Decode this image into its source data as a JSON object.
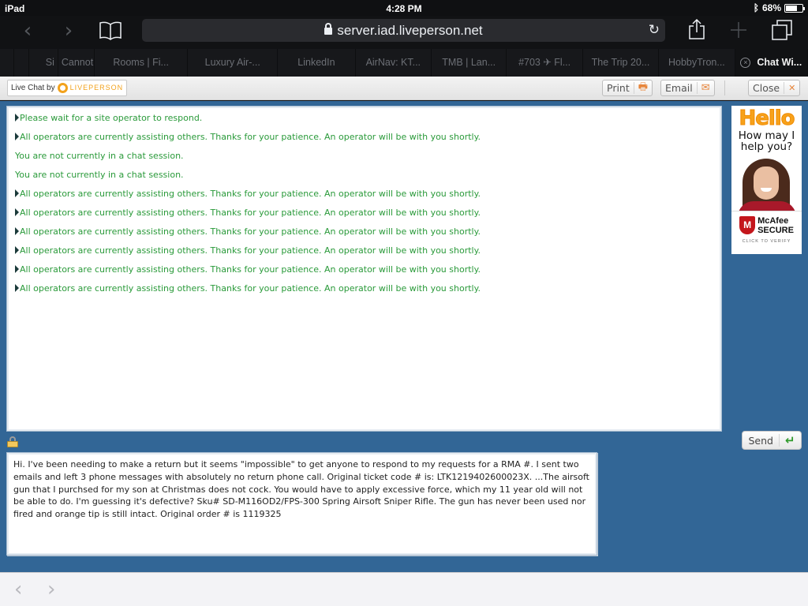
{
  "statusbar": {
    "device": "iPad",
    "time": "4:28 PM",
    "bluetooth_icon": "bluetooth-icon",
    "battery_percent": "68%",
    "battery_level": 0.68
  },
  "browser": {
    "url": "server.iad.liveperson.net",
    "icons": {
      "back": "chevron-left-icon",
      "forward": "chevron-right-icon",
      "bookmarks": "book-icon",
      "lock": "lock-icon",
      "reload": "reload-icon",
      "share": "share-icon",
      "new_tab": "plus-icon",
      "tabs": "tabs-icon"
    },
    "glyphs": {
      "back": "‹",
      "forward": "›",
      "reload": "↻"
    },
    "tabs": [
      {
        "label": ""
      },
      {
        "label": ""
      },
      {
        "label": "Si"
      },
      {
        "label": "Cannot ("
      },
      {
        "label": "Rooms | Fi..."
      },
      {
        "label": "Luxury Air-..."
      },
      {
        "label": "LinkedIn"
      },
      {
        "label": "AirNav: KT..."
      },
      {
        "label": "TMB | Lan..."
      },
      {
        "label": "#703 ✈ Fl..."
      },
      {
        "label": "The Trip 20..."
      },
      {
        "label": "HobbyTron..."
      },
      {
        "label": "Chat Wi...",
        "active": true
      }
    ],
    "tab_close_glyph": "×"
  },
  "liveperson": {
    "brand_prefix": "Live Chat by",
    "brand_name": "LIVEPERSON",
    "buttons": {
      "print": "Print",
      "email": "Email",
      "close": "Close",
      "send": "Send"
    },
    "button_glyphs": {
      "print": "🖶",
      "email": "✉",
      "close": "✕",
      "send": "↵"
    },
    "colors": {
      "panel_blue": "#326696",
      "message_green": "#2a9a3a",
      "brand_orange": "#f2a21c"
    }
  },
  "transcript": [
    {
      "arrow": true,
      "text": "Please wait for a site operator to respond."
    },
    {
      "arrow": true,
      "text": "All operators are currently assisting others. Thanks for your patience. An operator will be with you shortly."
    },
    {
      "arrow": false,
      "text": "You are not currently in a chat session."
    },
    {
      "arrow": false,
      "text": "You are not currently in a chat session."
    },
    {
      "arrow": true,
      "text": "All operators are currently assisting others. Thanks for your patience. An operator will be with you shortly."
    },
    {
      "arrow": true,
      "text": "All operators are currently assisting others. Thanks for your patience. An operator will be with you shortly."
    },
    {
      "arrow": true,
      "text": "All operators are currently assisting others. Thanks for your patience. An operator will be with you shortly."
    },
    {
      "arrow": true,
      "text": "All operators are currently assisting others. Thanks for your patience. An operator will be with you shortly."
    },
    {
      "arrow": true,
      "text": "All operators are currently assisting others. Thanks for your patience. An operator will be with you shortly."
    },
    {
      "arrow": true,
      "text": "All operators are currently assisting others. Thanks for your patience. An operator will be with you shortly."
    }
  ],
  "ad": {
    "hello": "Hello",
    "help": "How may I help you?",
    "mcafee_line1": "McAfee",
    "mcafee_line2": "SECURE",
    "mcafee_mark": "M",
    "verify": "CLICK TO VERIFY"
  },
  "message_input": {
    "value": "Hi. I've been needing to make a return but it seems \"impossible\" to get anyone to respond to my requests for a RMA #. I sent two emails and left 3 phone messages with absolutely no return phone call. Original ticket code # is: LTK1219402600023X. ...The airsoft gun that I purchsed for my son at Christmas does not cock. You would have to apply excessive force, which my 11 year old will not be able to do. I'm guessing it's defective? Sku# SD-M116OD2/FPS-300 Spring Airsoft Sniper Rifle. The gun has never been used nor fired and orange tip is still intact. Original order # is 1119325"
  }
}
